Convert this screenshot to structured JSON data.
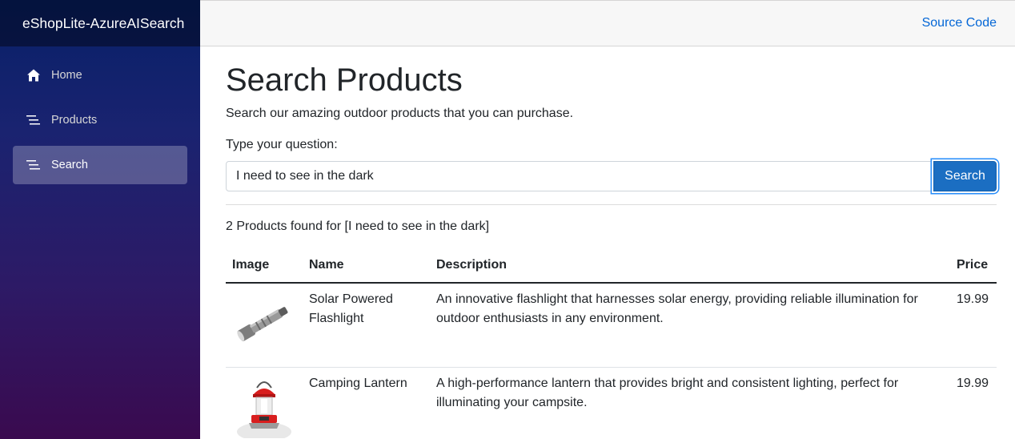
{
  "sidebar": {
    "brand": "eShopLite-AzureAISearch",
    "items": [
      {
        "label": "Home",
        "icon": "home-icon"
      },
      {
        "label": "Products",
        "icon": "list-icon"
      },
      {
        "label": "Search",
        "icon": "list-icon",
        "active": true
      }
    ]
  },
  "topbar": {
    "source_link": "Source Code"
  },
  "main": {
    "title": "Search Products",
    "subtitle": "Search our amazing outdoor products that you can purchase.",
    "question_label": "Type your question:",
    "search": {
      "value": "I need to see in the dark",
      "button_label": "Search"
    },
    "result_text": "2 Products found for [I need to see in the dark]",
    "table": {
      "headers": [
        "Image",
        "Name",
        "Description",
        "Price"
      ],
      "rows": [
        {
          "image": "flashlight-image",
          "name": "Solar Powered Flashlight",
          "description": "An innovative flashlight that harnesses solar energy, providing reliable illumination for outdoor enthusiasts in any environment.",
          "price": "19.99"
        },
        {
          "image": "lantern-image",
          "name": "Camping Lantern",
          "description": "A high-performance lantern that provides bright and consistent lighting, perfect for illuminating your campsite.",
          "price": "19.99"
        }
      ]
    }
  },
  "colors": {
    "accent": "#1b6ec2",
    "link": "#0366d6"
  }
}
